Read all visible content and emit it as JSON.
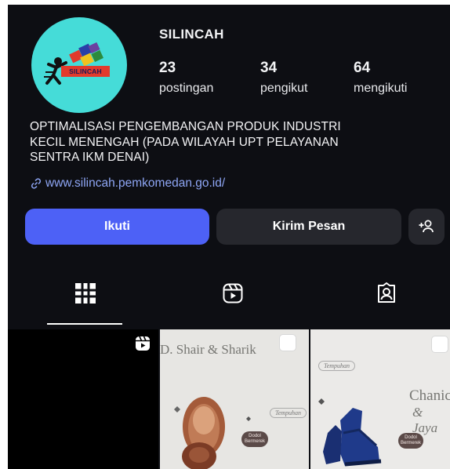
{
  "profile": {
    "username": "SILINCAH",
    "avatar_logo_text": "SILINCAH",
    "stats": [
      {
        "count": "23",
        "label": "postingan"
      },
      {
        "count": "34",
        "label": "pengikut"
      },
      {
        "count": "64",
        "label": "mengikuti"
      }
    ],
    "bio_lines": [
      "OPTIMALISASI PENGEMBANGAN PRODUK INDUSTRI",
      "KECIL MENENGAH (PADA WILAYAH UPT PELAYANAN",
      "SENTRA IKM DENAI)"
    ],
    "link": "www.silincah.pemkomedan.go.id/"
  },
  "actions": {
    "follow_label": "Ikuti",
    "message_label": "Kirim Pesan",
    "suggest_icon": "add-person-icon"
  },
  "tabs": [
    {
      "icon": "grid-icon",
      "active": true
    },
    {
      "icon": "reels-icon",
      "active": false
    },
    {
      "icon": "tagged-icon",
      "active": false
    }
  ],
  "posts": [
    {
      "type": "reel"
    },
    {
      "title": "D. Shair & Sharik",
      "tag": "Tempuhan",
      "pill": "Dodol Bermerek"
    },
    {
      "title_line1": "Chanic",
      "title_line2": "& Jaya",
      "tag": "Tempuhan",
      "pill": "Dodol Bermerek"
    }
  ],
  "colors": {
    "background": "#0d0e13",
    "follow_button": "#4d61f6",
    "secondary_button": "#26272d",
    "avatar": "#45dcd8",
    "link": "#8ea6f5"
  }
}
